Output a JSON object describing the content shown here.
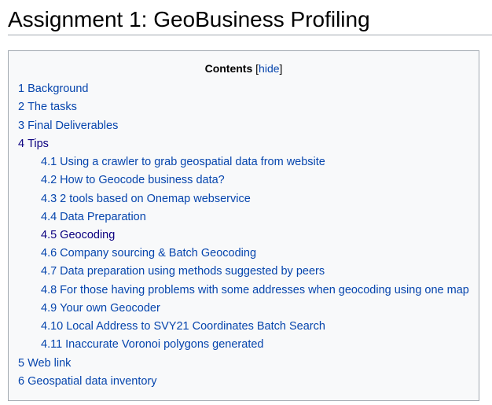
{
  "page": {
    "title": "Assignment 1: GeoBusiness Profiling"
  },
  "toc": {
    "heading": "Contents",
    "toggle_open": "[",
    "toggle_label": "hide",
    "toggle_close": "]",
    "items": [
      {
        "num": "1",
        "text": "Background",
        "level": 1,
        "visited": false
      },
      {
        "num": "2",
        "text": "The tasks",
        "level": 1,
        "visited": false
      },
      {
        "num": "3",
        "text": "Final Deliverables",
        "level": 1,
        "visited": false
      },
      {
        "num": "4",
        "text": "Tips",
        "level": 1,
        "visited": true
      },
      {
        "num": "4.1",
        "text": "Using a crawler to grab geospatial data from website",
        "level": 2,
        "visited": false
      },
      {
        "num": "4.2",
        "text": "How to Geocode business data?",
        "level": 2,
        "visited": false
      },
      {
        "num": "4.3",
        "text": "2 tools based on Onemap webservice",
        "level": 2,
        "visited": false
      },
      {
        "num": "4.4",
        "text": "Data Preparation",
        "level": 2,
        "visited": false
      },
      {
        "num": "4.5",
        "text": "Geocoding",
        "level": 2,
        "visited": true
      },
      {
        "num": "4.6",
        "text": "Company sourcing & Batch Geocoding",
        "level": 2,
        "visited": false
      },
      {
        "num": "4.7",
        "text": "Data preparation using methods suggested by peers",
        "level": 2,
        "visited": false
      },
      {
        "num": "4.8",
        "text": "For those having problems with some addresses when geocoding using one map",
        "level": 2,
        "visited": false
      },
      {
        "num": "4.9",
        "text": "Your own Geocoder",
        "level": 2,
        "visited": false
      },
      {
        "num": "4.10",
        "text": "Local Address to SVY21 Coordinates Batch Search",
        "level": 2,
        "visited": false
      },
      {
        "num": "4.11",
        "text": "Inaccurate Voronoi polygons generated",
        "level": 2,
        "visited": false
      },
      {
        "num": "5",
        "text": "Web link",
        "level": 1,
        "visited": false
      },
      {
        "num": "6",
        "text": "Geospatial data inventory",
        "level": 1,
        "visited": false
      }
    ]
  },
  "colors": {
    "link": "#0645ad",
    "visited_link": "#0b0080",
    "toc_background": "#f8f9fa",
    "border": "#a2a9b1"
  }
}
